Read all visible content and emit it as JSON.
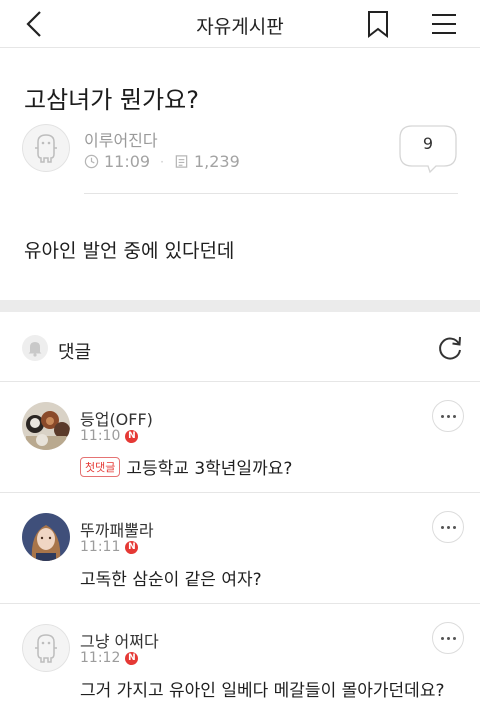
{
  "header": {
    "title": "자유게시판"
  },
  "post": {
    "title": "고삼녀가 뭔가요?",
    "author": "이루어진다",
    "time": "11:09",
    "views": "1,239",
    "comment_count": "9",
    "body": "유아인 발언 중에 있다던데"
  },
  "comments_section": {
    "label": "댓글"
  },
  "comments": [
    {
      "author": "등업(OFF)",
      "time": "11:10",
      "badge": "N",
      "tag": "첫댓글",
      "text": "고등학교 3학년일까요?"
    },
    {
      "author": "뚜까패뿔라",
      "time": "11:11",
      "badge": "N",
      "text": "고독한 삼순이 같은 여자?"
    },
    {
      "author": "그냥 어쩌다",
      "time": "11:12",
      "badge": "N",
      "text": "그거 가지고 유아인 일베다 메갈들이 몰아가던데요?"
    }
  ],
  "icons": {
    "back": "chevron-left-icon",
    "bookmark": "bookmark-icon",
    "menu": "hamburger-menu-icon",
    "clock": "clock-icon",
    "views": "document-icon",
    "bell": "bell-icon",
    "refresh": "refresh-icon",
    "more": "more-dots-icon"
  },
  "colors": {
    "badge": "#e53935",
    "muted_text": "#9a9a9a",
    "divider": "#e6e6e6",
    "section_gap": "#ebebeb"
  }
}
